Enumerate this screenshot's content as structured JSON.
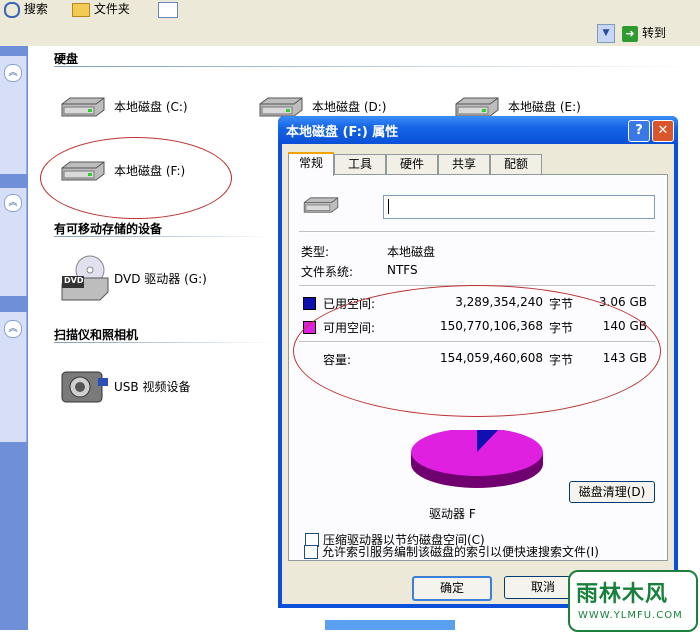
{
  "toolbar": {
    "search_label": "搜索",
    "folders_label": "文件夹",
    "go_label": "转到"
  },
  "sections": {
    "hard_disks": "硬盘",
    "removable": "有可移动存储的设备",
    "scanners": "扫描仪和照相机"
  },
  "drives": {
    "c": "本地磁盘 (C:)",
    "d": "本地磁盘 (D:)",
    "e": "本地磁盘 (E:)",
    "f": "本地磁盘 (F:)",
    "dvd": "DVD 驱动器 (G:)",
    "dvd_icon_text": "DVD",
    "usb": "USB 视频设备"
  },
  "dialog": {
    "title": "本地磁盘 (F:) 属性",
    "help": "?",
    "close": "✕",
    "tabs": [
      "常规",
      "工具",
      "硬件",
      "共享",
      "配额"
    ],
    "name_value": "",
    "type_label": "类型:",
    "type_value": "本地磁盘",
    "fs_label": "文件系统:",
    "fs_value": "NTFS",
    "used_label": "已用空间:",
    "used_bytes": "3,289,354,240",
    "used_unit": "字节",
    "used_gb": "3.06 GB",
    "free_label": "可用空间:",
    "free_bytes": "150,770,106,368",
    "free_unit": "字节",
    "free_gb": "140 GB",
    "cap_label": "容量:",
    "cap_bytes": "154,059,460,608",
    "cap_unit": "字节",
    "cap_gb": "143 GB",
    "drive_label": "驱动器 F",
    "cleanup_button": "磁盘清理(D)",
    "compress_label": "压缩驱动器以节约磁盘空间(C)",
    "index_label": "允许索引服务编制该磁盘的索引以便快速搜索文件(I)",
    "ok_button": "确定",
    "cancel_button": "取消"
  },
  "colors": {
    "used": "#1010b0",
    "free": "#e020e0"
  },
  "usage": {
    "used_fraction": 0.0214
  },
  "logo": {
    "main": "雨林木风",
    "url": "WWW.YLMFU.COM"
  }
}
